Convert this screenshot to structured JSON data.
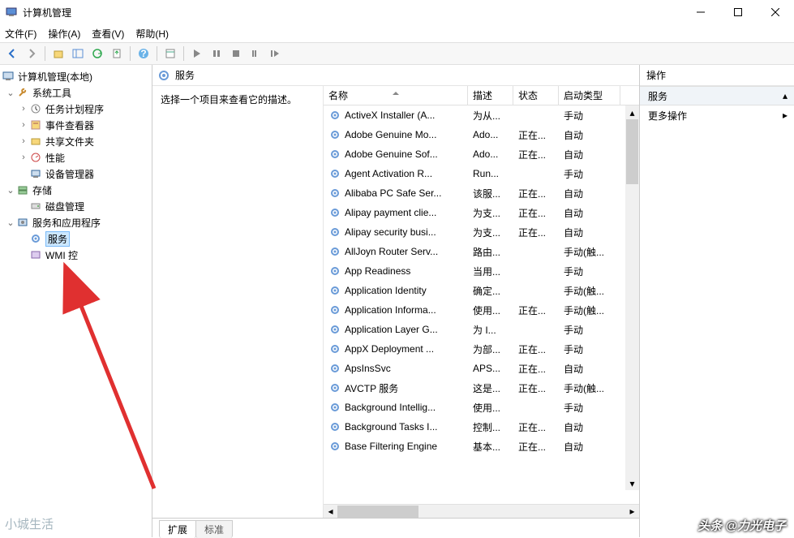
{
  "window": {
    "title": "计算机管理"
  },
  "menu": {
    "file": "文件(F)",
    "action": "操作(A)",
    "view": "查看(V)",
    "help": "帮助(H)"
  },
  "tree": {
    "root": "计算机管理(本地)",
    "systools": "系统工具",
    "tasksched": "任务计划程序",
    "eventvwr": "事件查看器",
    "shared": "共享文件夹",
    "perf": "性能",
    "devmgr": "设备管理器",
    "storage": "存储",
    "diskmgmt": "磁盘管理",
    "svcapps": "服务和应用程序",
    "services": "服务",
    "wmi": "WMI 控"
  },
  "center": {
    "title": "服务",
    "hint": "选择一个项目来查看它的描述。",
    "cols": {
      "name": "名称",
      "desc": "描述",
      "status": "状态",
      "startup": "启动类型"
    },
    "tabs": {
      "ext": "扩展",
      "std": "标准"
    }
  },
  "services": [
    {
      "n": "ActiveX Installer (A...",
      "d": "为从...",
      "s": "",
      "t": "手动"
    },
    {
      "n": "Adobe Genuine Mo...",
      "d": "Ado...",
      "s": "正在...",
      "t": "自动"
    },
    {
      "n": "Adobe Genuine Sof...",
      "d": "Ado...",
      "s": "正在...",
      "t": "自动"
    },
    {
      "n": "Agent Activation R...",
      "d": "Run...",
      "s": "",
      "t": "手动"
    },
    {
      "n": "Alibaba PC Safe Ser...",
      "d": "该服...",
      "s": "正在...",
      "t": "自动"
    },
    {
      "n": "Alipay payment clie...",
      "d": "为支...",
      "s": "正在...",
      "t": "自动"
    },
    {
      "n": "Alipay security busi...",
      "d": "为支...",
      "s": "正在...",
      "t": "自动"
    },
    {
      "n": "AllJoyn Router Serv...",
      "d": "路由...",
      "s": "",
      "t": "手动(触..."
    },
    {
      "n": "App Readiness",
      "d": "当用...",
      "s": "",
      "t": "手动"
    },
    {
      "n": "Application Identity",
      "d": "确定...",
      "s": "",
      "t": "手动(触..."
    },
    {
      "n": "Application Informa...",
      "d": "使用...",
      "s": "正在...",
      "t": "手动(触..."
    },
    {
      "n": "Application Layer G...",
      "d": "为 I...",
      "s": "",
      "t": "手动"
    },
    {
      "n": "AppX Deployment ...",
      "d": "为部...",
      "s": "正在...",
      "t": "手动"
    },
    {
      "n": "ApsInsSvc",
      "d": "APS...",
      "s": "正在...",
      "t": "自动"
    },
    {
      "n": "AVCTP 服务",
      "d": "这是...",
      "s": "正在...",
      "t": "手动(触..."
    },
    {
      "n": "Background Intellig...",
      "d": "使用...",
      "s": "",
      "t": "手动"
    },
    {
      "n": "Background Tasks I...",
      "d": "控制...",
      "s": "正在...",
      "t": "自动"
    },
    {
      "n": "Base Filtering Engine",
      "d": "基本...",
      "s": "正在...",
      "t": "自动"
    }
  ],
  "actions": {
    "title": "操作",
    "section": "服务",
    "more": "更多操作"
  },
  "watermark": {
    "right": "头条 @力光电子",
    "left": "小城生活"
  }
}
